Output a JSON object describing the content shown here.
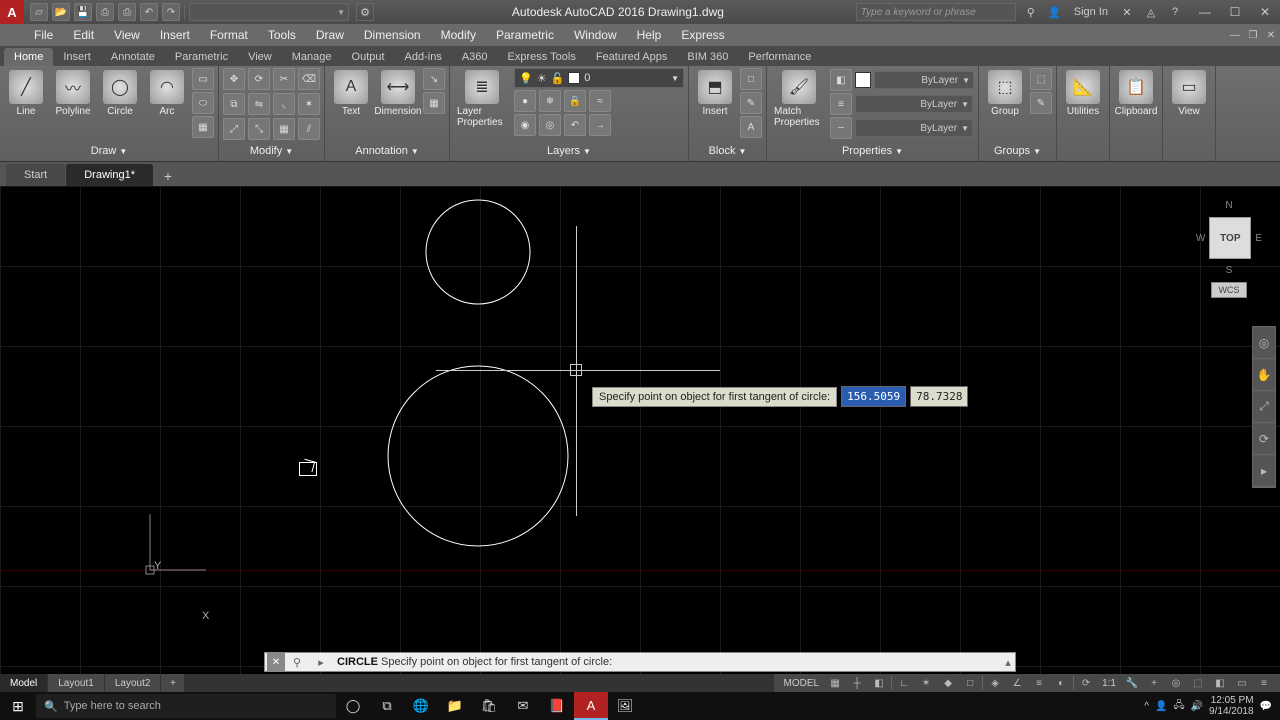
{
  "app": {
    "title": "Autodesk AutoCAD 2016   Drawing1.dwg"
  },
  "search_placeholder": "Type a keyword or phrase",
  "signin": "Sign In",
  "menus": [
    "File",
    "Edit",
    "View",
    "Insert",
    "Format",
    "Tools",
    "Draw",
    "Dimension",
    "Modify",
    "Parametric",
    "Window",
    "Help",
    "Express"
  ],
  "ribbon_tabs": [
    "Home",
    "Insert",
    "Annotate",
    "Parametric",
    "View",
    "Manage",
    "Output",
    "Add-ins",
    "A360",
    "Express Tools",
    "Featured Apps",
    "BIM 360",
    "Performance"
  ],
  "ribbon_active": "Home",
  "panels": {
    "draw": {
      "title": "Draw",
      "big": [
        "Line",
        "Polyline",
        "Circle",
        "Arc"
      ]
    },
    "modify": {
      "title": "Modify"
    },
    "annotation": {
      "title": "Annotation",
      "big": [
        "Text",
        "Dimension"
      ]
    },
    "layers": {
      "title": "Layers",
      "big": "Layer Properties",
      "current": "0"
    },
    "block": {
      "title": "Block",
      "big": [
        "Insert"
      ]
    },
    "properties": {
      "title": "Properties",
      "match": "Match Properties",
      "rows": [
        "ByLayer",
        "ByLayer",
        "ByLayer"
      ]
    },
    "groups": {
      "title": "Groups",
      "big": "Group"
    },
    "utilities": {
      "title": "Utilities"
    },
    "clipboard": {
      "title": "Clipboard"
    },
    "view": {
      "title": "View"
    }
  },
  "doc_tabs": {
    "start": "Start",
    "active": "Drawing1*"
  },
  "viewcube": {
    "top": "TOP",
    "n": "N",
    "s": "S",
    "e": "E",
    "w": "W",
    "wcs": "WCS"
  },
  "ucs": {
    "x": "X",
    "y": "Y"
  },
  "dynamic_input": {
    "prompt": "Specify point on object for first tangent of circle:",
    "x": "156.5059",
    "y": "78.7328"
  },
  "command_line": {
    "cmd": "CIRCLE",
    "text": " Specify point on object for first tangent of circle:"
  },
  "layout_tabs": [
    "Model",
    "Layout1",
    "Layout2"
  ],
  "status": {
    "model": "MODEL",
    "scale": "1:1"
  },
  "taskbar": {
    "search": "Type here to search",
    "time": "12:05 PM",
    "date": "9/14/2018"
  }
}
